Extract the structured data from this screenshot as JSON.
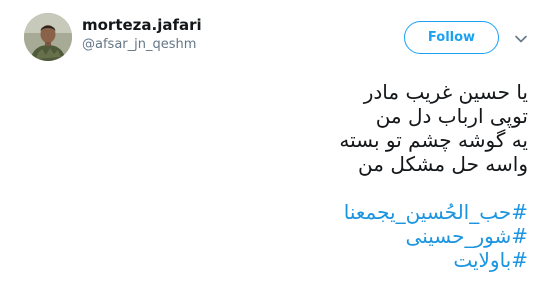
{
  "user": {
    "display_name": "morteza.jafari",
    "screen_name": "@afsar_jn_qeshm"
  },
  "follow_button_label": "Follow",
  "more_menu_icon": "chevron-down-icon",
  "tweet": {
    "lines": [
      "یا حسین غریب مادر",
      "توپی ارباب دل من",
      "یه گوشه چشم تو بسته",
      "واسه حل مشکل من"
    ],
    "hashtags": [
      "#حب_الحُسین_یجمعنا",
      "#شور_حسینی",
      "#باولایت"
    ]
  },
  "colors": {
    "accent": "#1da1f2",
    "hashtag": "#1b95e0",
    "text": "#14171a",
    "secondary_text": "#657786"
  }
}
